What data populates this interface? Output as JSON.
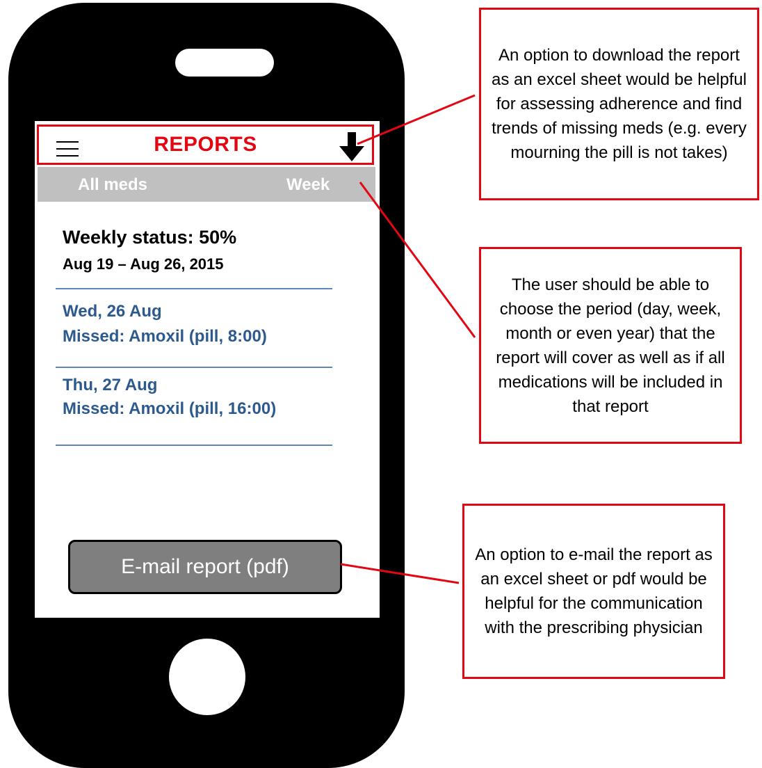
{
  "header": {
    "title": "REPORTS",
    "menu_icon": "hamburger-menu-icon",
    "download_icon": "download-arrow-icon"
  },
  "filters": {
    "medications": "All meds",
    "period": "Week"
  },
  "status": {
    "title": "Weekly status: 50%",
    "range": "Aug 19 – Aug 26, 2015"
  },
  "entries": [
    {
      "date": "Wed, 26 Aug",
      "missed": "Missed: Amoxil (pill, 8:00)"
    },
    {
      "date": "Thu, 27 Aug",
      "missed": "Missed: Amoxil (pill, 16:00)"
    }
  ],
  "email_button_label": "E-mail report (pdf)",
  "annotations": [
    {
      "text": "An option to download the report as an excel sheet would be helpful for assessing adherence and find trends of missing meds (e.g. every mourning the pill is not takes)"
    },
    {
      "text": "The user should be able to choose the period (day, week, month or even year) that the report will cover as well as if all medications will be included in that report"
    },
    {
      "text": "An option to e-mail the report as an excel sheet or pdf would be helpful for the communication with the prescribing physician"
    }
  ],
  "colors": {
    "accent_red": "#e30613",
    "entry_blue": "#2c5a8f",
    "divider_blue": "#5b86c0",
    "filter_bar_gray": "#c0c0c0",
    "button_gray": "#7f7f7f"
  }
}
